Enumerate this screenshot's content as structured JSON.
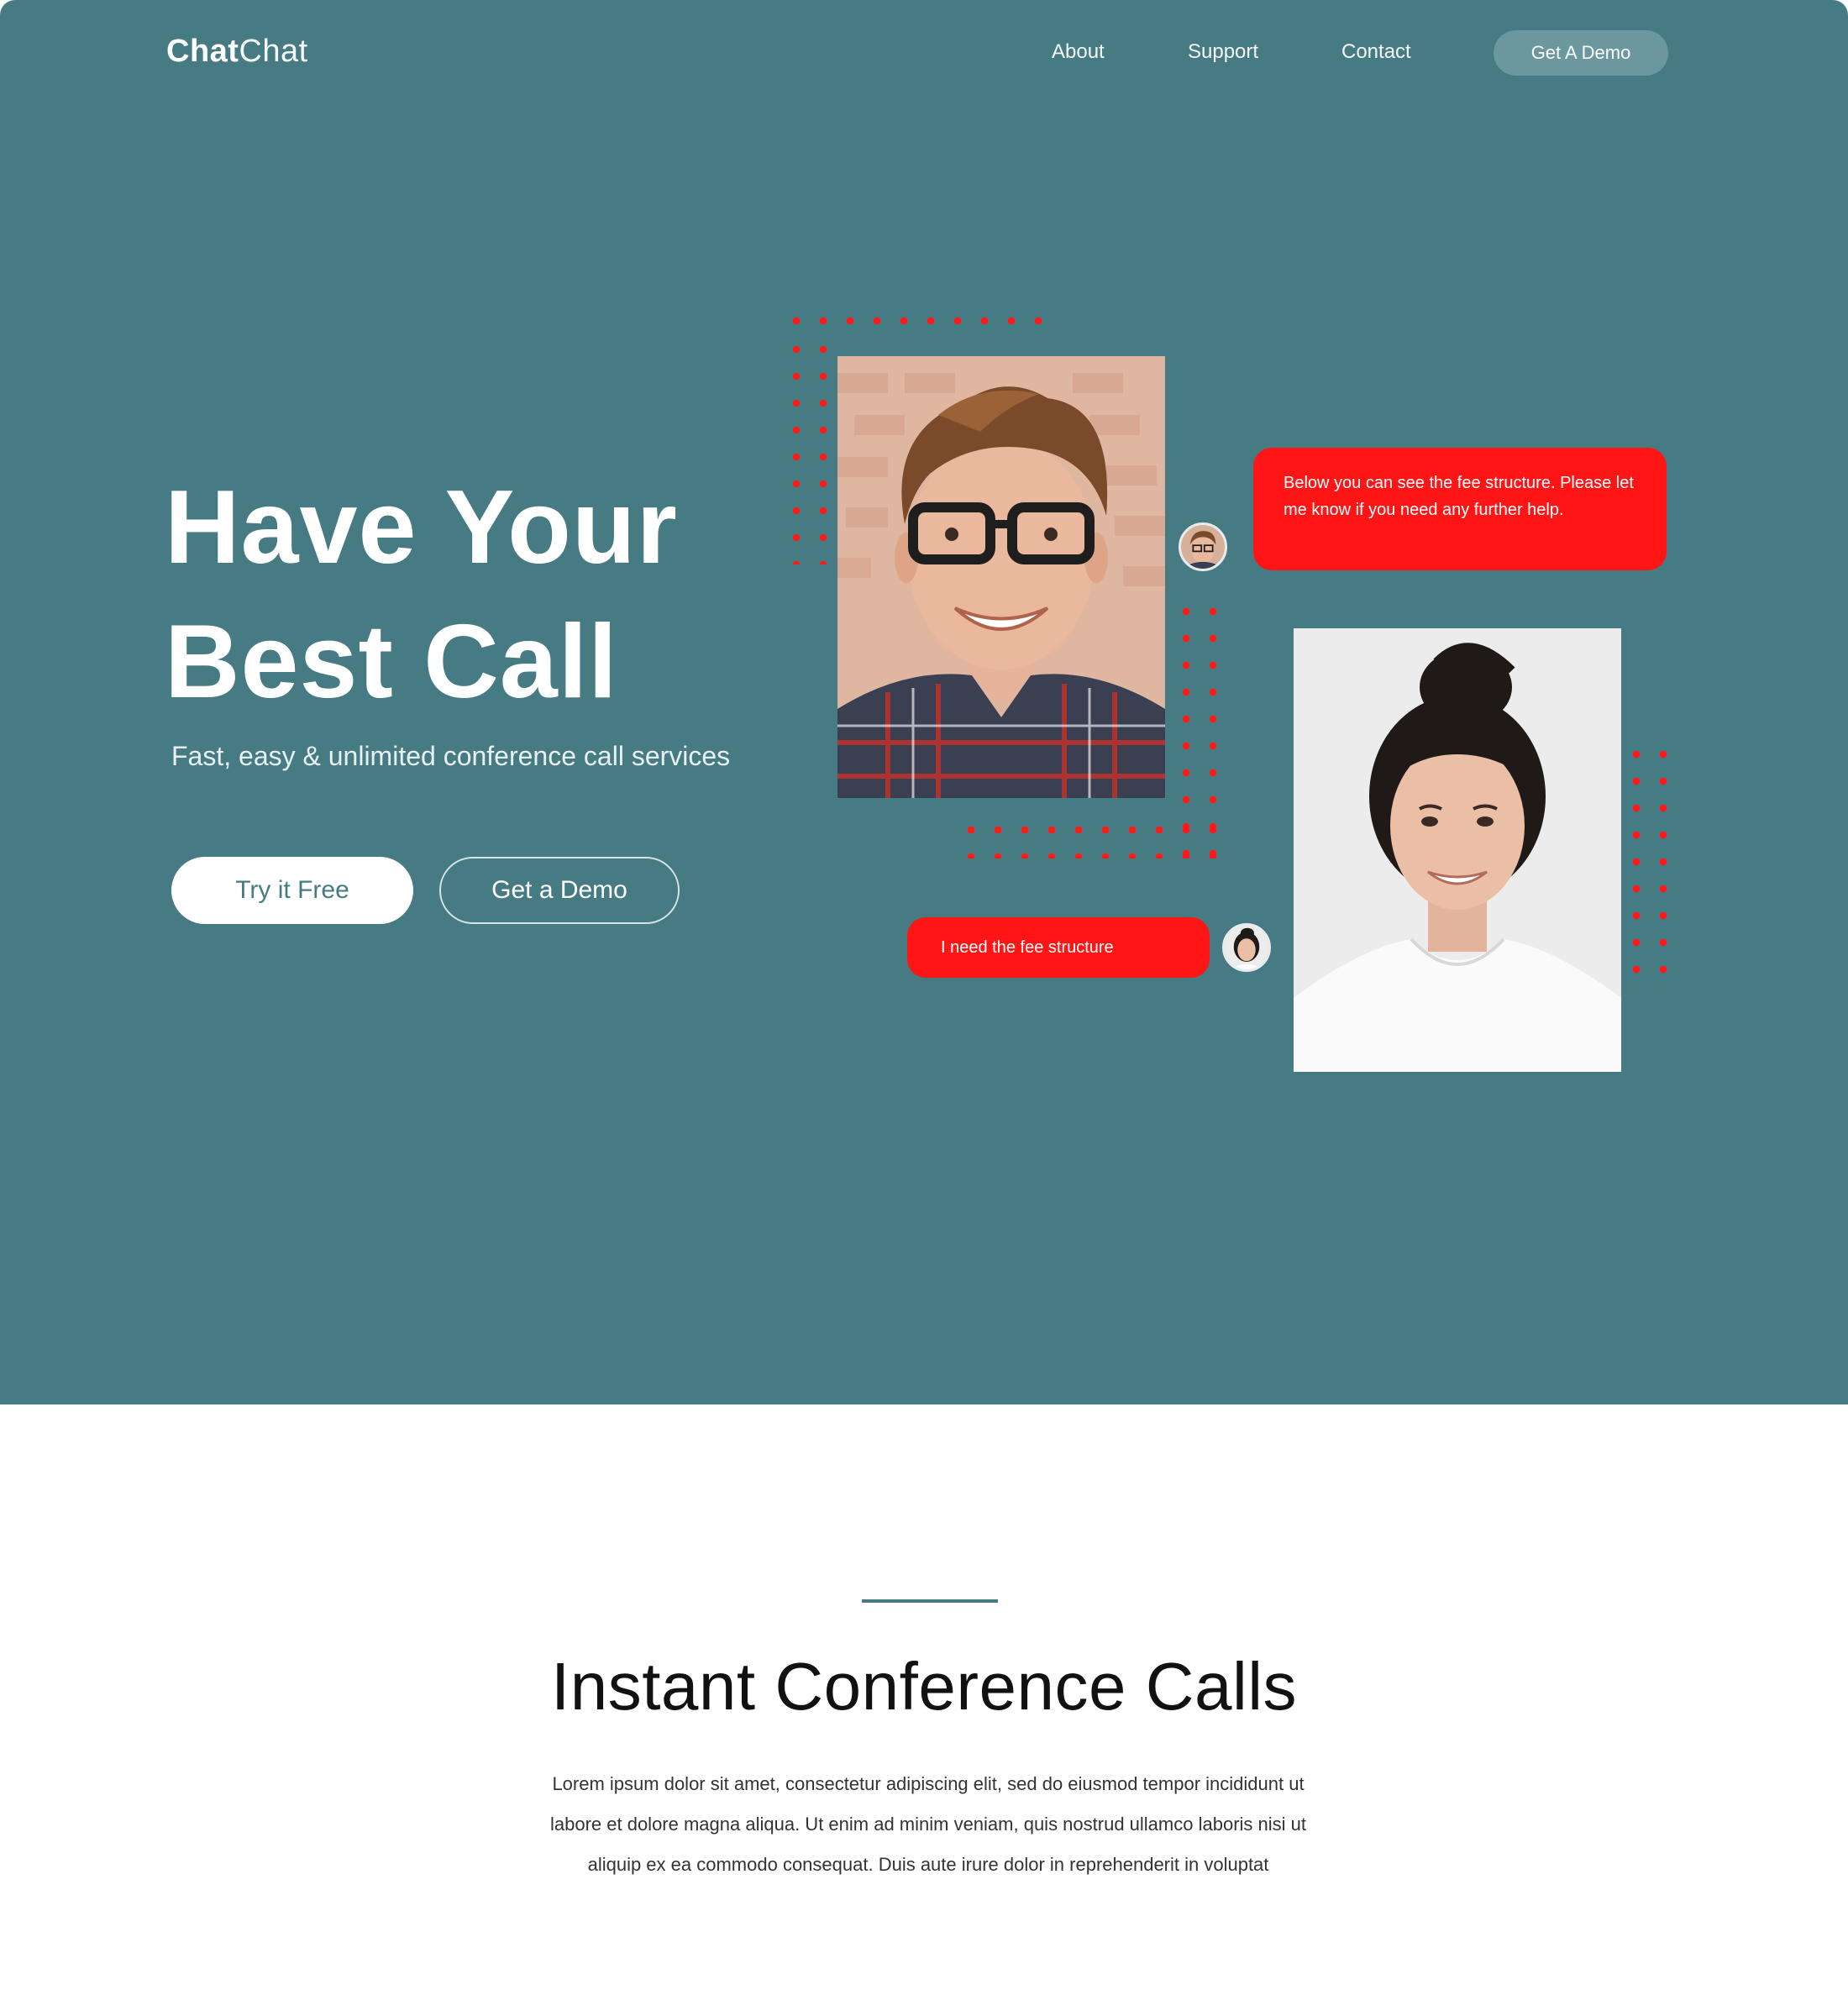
{
  "nav": {
    "logo_bold": "Chat",
    "logo_light": "Chat",
    "links": [
      "About",
      "Support",
      "Contact"
    ],
    "cta_label": "Get A Demo"
  },
  "hero": {
    "title_line1": "Have Your",
    "title_line2": "Best Call",
    "subtitle": "Fast, easy & unlimited conference call services",
    "primary_button": "Try it Free",
    "secondary_button": "Get a Demo"
  },
  "chat": {
    "bubble_1": "Below you can see the fee structure. Please let me know if you need any further help.",
    "bubble_2": "I need the fee structure"
  },
  "section": {
    "title": "Instant Conference Calls",
    "body": "Lorem ipsum dolor sit amet, consectetur adipiscing elit, sed do eiusmod tempor incididunt ut labore et dolore magna aliqua. Ut enim ad minim veniam, quis nostrud ullamco laboris nisi ut aliquip ex ea commodo consequat. Duis aute irure dolor in reprehenderit in voluptat"
  },
  "colors": {
    "hero_bg": "#467b84",
    "accent_red": "#ff1515",
    "white": "#ffffff",
    "cta_bg": "#6b979e"
  }
}
